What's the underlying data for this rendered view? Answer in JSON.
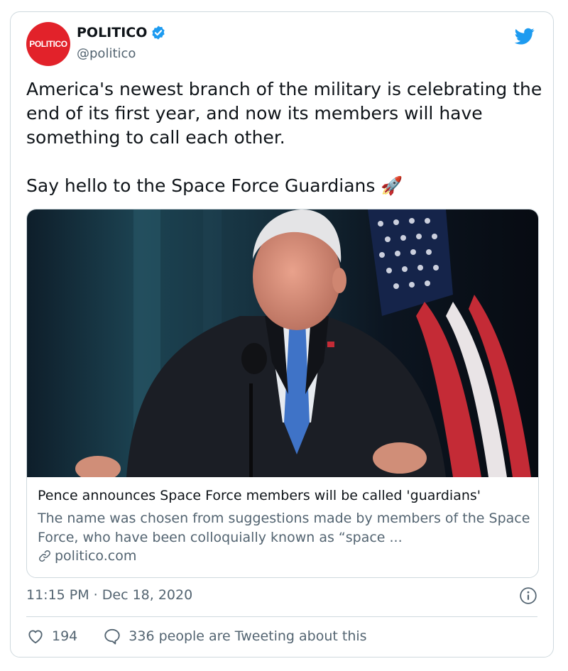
{
  "author": {
    "avatar_text": "POLITICO",
    "display_name": "POLITICO",
    "handle": "@politico",
    "verified": true,
    "brand_color": "#e2222a"
  },
  "tweet": {
    "text": "America's newest branch of the military is celebrating the end of its first year, and now its members will have something to call each other.\n\nSay hello to the Space Force Guardians 🚀"
  },
  "link_card": {
    "title": "Pence announces Space Force members will be called 'guardians'",
    "description": "The name was chosen from suggestions made by members of the Space Force, who have been colloquially known as “space ...",
    "domain": "politico.com"
  },
  "meta": {
    "timestamp": "11:15 PM · Dec 18, 2020"
  },
  "actions": {
    "likes": "194",
    "replies_label": "336 people are Tweeting about this"
  },
  "icons": [
    "verified-badge-icon",
    "twitter-bird-icon",
    "link-icon",
    "info-icon",
    "heart-icon",
    "reply-bubble-icon"
  ],
  "colors": {
    "twitter_blue": "#1d9bf0",
    "text_primary": "#0f1419",
    "text_secondary": "#536471",
    "border": "#cfd9de"
  }
}
